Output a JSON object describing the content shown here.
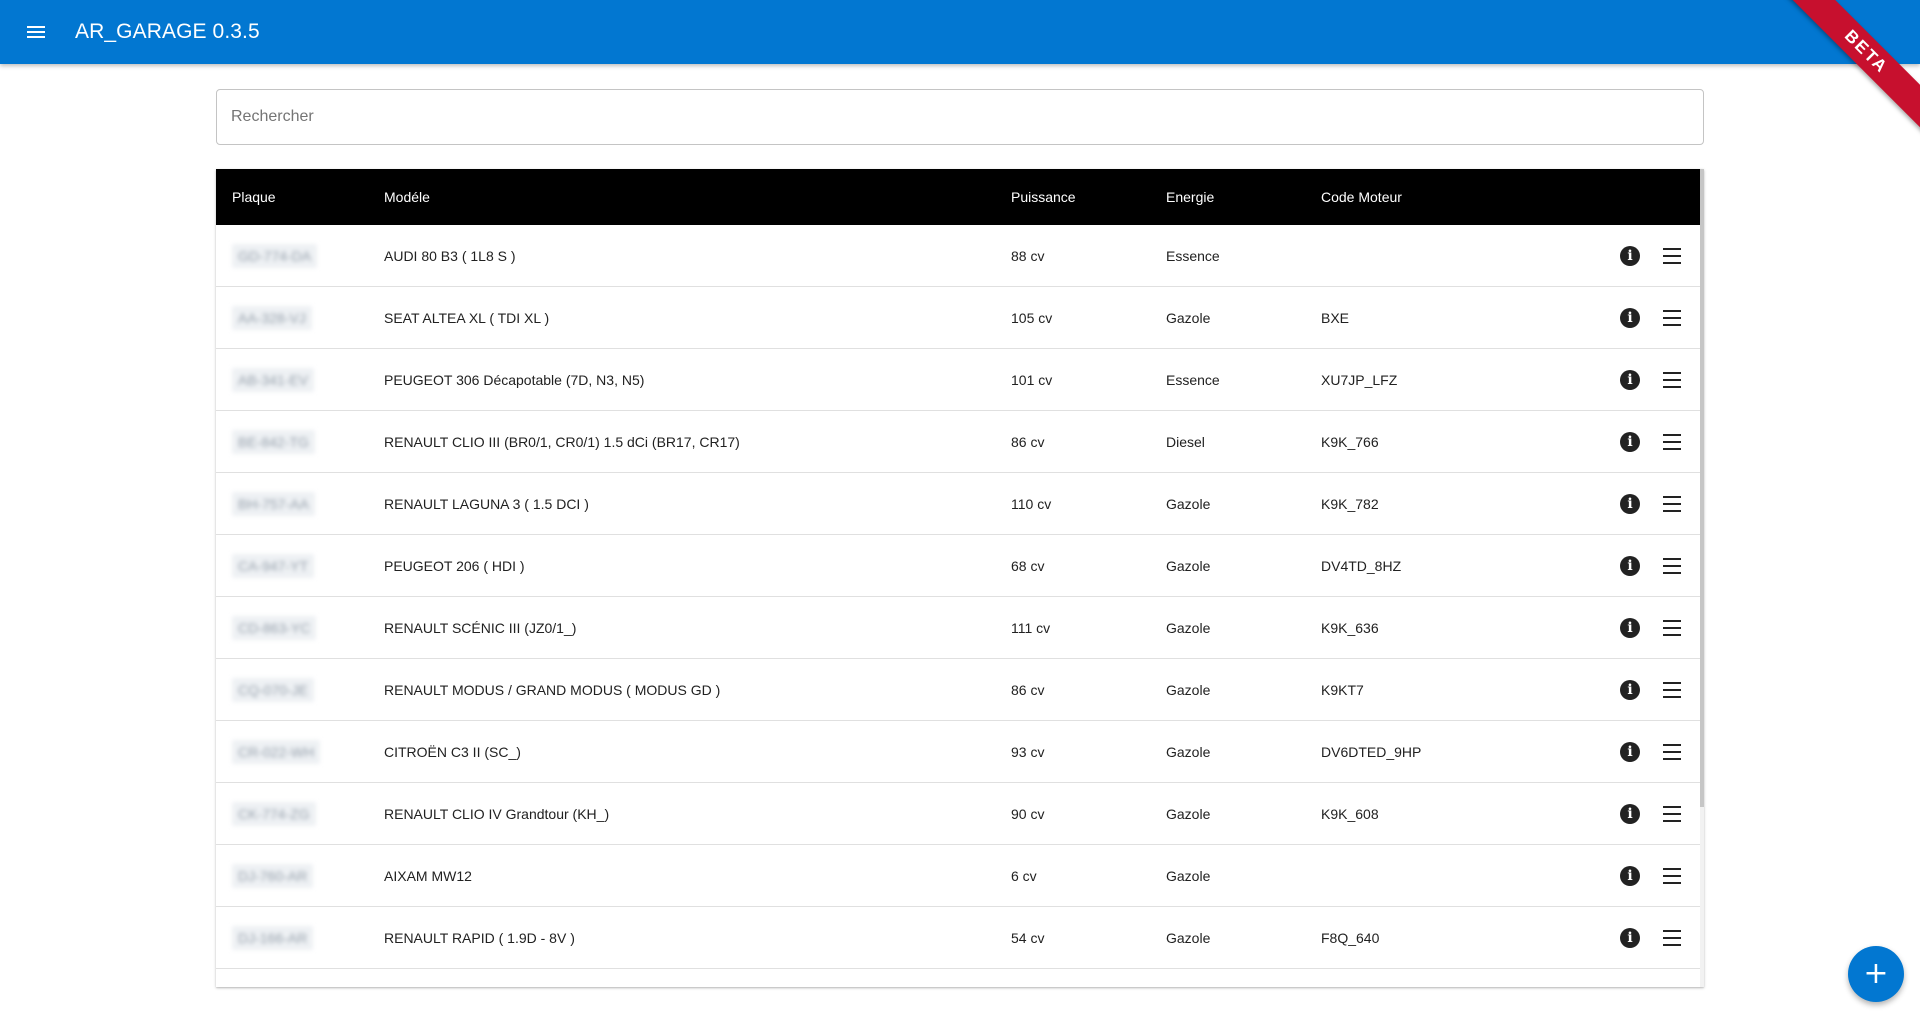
{
  "app": {
    "title": "AR_GARAGE 0.3.5",
    "ribbon": "BETA"
  },
  "search": {
    "placeholder": "Rechercher",
    "value": ""
  },
  "table": {
    "columns": [
      "Plaque",
      "Modéle",
      "Puissance",
      "Energie",
      "Code Moteur"
    ],
    "rows": [
      {
        "plate": "GD-774-DA",
        "model": "AUDI 80 B3 ( 1L8 S )",
        "power": "88 cv",
        "energy": "Essence",
        "code": ""
      },
      {
        "plate": "AA-328-VJ",
        "model": "SEAT ALTEA XL ( TDI XL )",
        "power": "105 cv",
        "energy": "Gazole",
        "code": "BXE"
      },
      {
        "plate": "AB-341-EV",
        "model": "PEUGEOT 306 Décapotable (7D, N3, N5)",
        "power": "101 cv",
        "energy": "Essence",
        "code": "XU7JP_LFZ"
      },
      {
        "plate": "BE-842-TG",
        "model": "RENAULT CLIO III (BR0/1, CR0/1) 1.5 dCi (BR17, CR17)",
        "power": "86 cv",
        "energy": "Diesel",
        "code": "K9K_766"
      },
      {
        "plate": "BH-757-AA",
        "model": "RENAULT LAGUNA 3 ( 1.5 DCI )",
        "power": "110 cv",
        "energy": "Gazole",
        "code": "K9K_782"
      },
      {
        "plate": "CA-947-YT",
        "model": "PEUGEOT 206 ( HDI )",
        "power": "68 cv",
        "energy": "Gazole",
        "code": "DV4TD_8HZ"
      },
      {
        "plate": "CD-863-YC",
        "model": "RENAULT SCÉNIC III (JZ0/1_)",
        "power": "111 cv",
        "energy": "Gazole",
        "code": "K9K_636"
      },
      {
        "plate": "CQ-070-JE",
        "model": "RENAULT MODUS / GRAND MODUS ( MODUS GD )",
        "power": "86 cv",
        "energy": "Gazole",
        "code": "K9KT7"
      },
      {
        "plate": "CR-022-WH",
        "model": "CITROËN C3 II (SC_)",
        "power": "93 cv",
        "energy": "Gazole",
        "code": "DV6DTED_9HP"
      },
      {
        "plate": "CK-774-ZG",
        "model": "RENAULT CLIO IV Grandtour (KH_)",
        "power": "90 cv",
        "energy": "Gazole",
        "code": "K9K_608"
      },
      {
        "plate": "DJ-760-AR",
        "model": "AIXAM MW12",
        "power": "6 cv",
        "energy": "Gazole",
        "code": ""
      },
      {
        "plate": "DJ-166-AR",
        "model": "RENAULT RAPID ( 1.9D - 8V )",
        "power": "54 cv",
        "energy": "Gazole",
        "code": "F8Q_640"
      }
    ]
  },
  "actions": {
    "info_icon": "info-icon",
    "menu_icon": "hamburger-icon",
    "add_icon": "plus-icon"
  },
  "colors": {
    "primary": "#0277d1",
    "ribbon": "#c7102e",
    "header_bg": "#000000"
  }
}
